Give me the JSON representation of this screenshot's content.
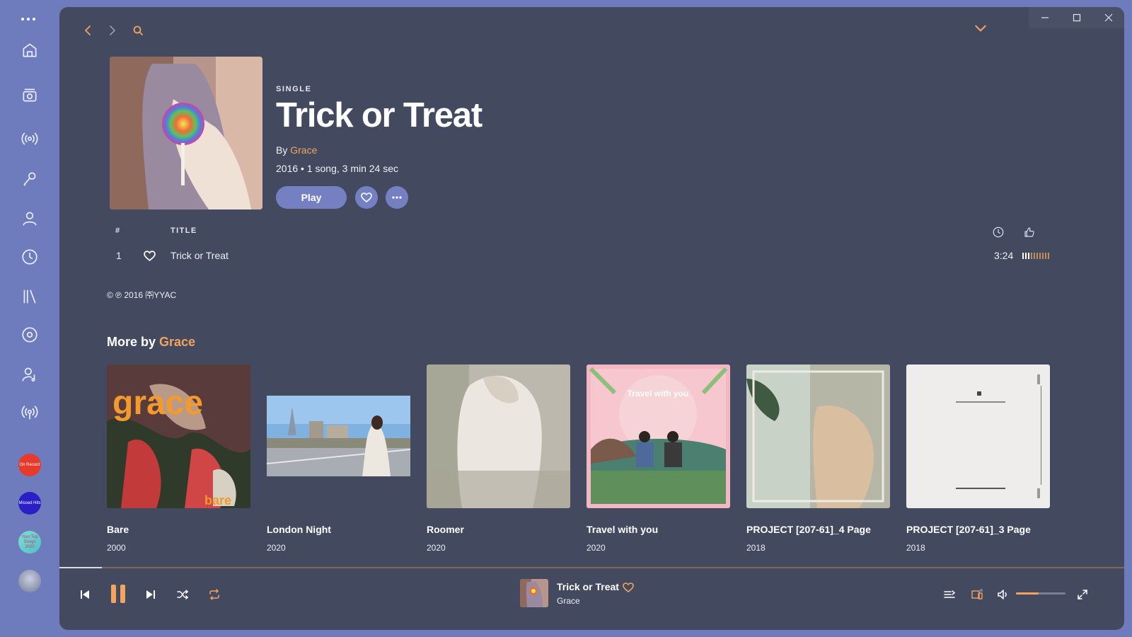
{
  "app": {
    "colors": {
      "accent": "#f3a35d",
      "rail": "#6e7bbd",
      "window": "#434a5f",
      "button": "#7480c2"
    }
  },
  "sidebar": {
    "menu_icon": "more-dots-icon",
    "items": [
      {
        "id": "home",
        "icon": "home-icon"
      },
      {
        "id": "radio",
        "icon": "radio-icon"
      },
      {
        "id": "live",
        "icon": "broadcast-icon"
      },
      {
        "id": "search",
        "icon": "microphone-icon"
      },
      {
        "id": "artists",
        "icon": "user-icon"
      },
      {
        "id": "recent",
        "icon": "clock-icon"
      },
      {
        "id": "library",
        "icon": "library-icon"
      },
      {
        "id": "albums",
        "icon": "disc-icon"
      },
      {
        "id": "following",
        "icon": "user-music-icon"
      },
      {
        "id": "podcasts",
        "icon": "podcast-icon"
      }
    ],
    "playlists": [
      {
        "label": "On Record",
        "color": "#e83a2a"
      },
      {
        "label": "Missed Hits",
        "color": "#2a1fc7"
      },
      {
        "label": "Your Top Songs 2020",
        "color": "#6fd6cf"
      },
      {
        "label": "",
        "color": "#8b93a8"
      }
    ]
  },
  "album": {
    "type": "SINGLE",
    "title": "Trick or Treat",
    "by_prefix": "By",
    "artist": "Grace",
    "info": "2016 • 1 song, 3 min 24 sec",
    "play_label": "Play"
  },
  "tracks": {
    "header_num": "#",
    "header_title": "TITLE",
    "rows": [
      {
        "num": "1",
        "title": "Trick or Treat",
        "duration": "3:24",
        "popularity": 0.3
      }
    ]
  },
  "copyright": "© ℗ 2016 ㈜YYAC",
  "more": {
    "prefix": "More by",
    "artist": "Grace",
    "cards": [
      {
        "name": "Bare",
        "year": "2000"
      },
      {
        "name": "London Night",
        "year": "2020"
      },
      {
        "name": "Roomer",
        "year": "2020"
      },
      {
        "name": "Travel with you",
        "year": "2020"
      },
      {
        "name": "PROJECT [207-61]_4 Page",
        "year": "2018"
      },
      {
        "name": "PROJECT [207-61]_3 Page",
        "year": "2018"
      }
    ]
  },
  "player": {
    "title": "Trick or Treat",
    "artist": "Grace",
    "progress": 0.04,
    "volume": 0.45
  }
}
